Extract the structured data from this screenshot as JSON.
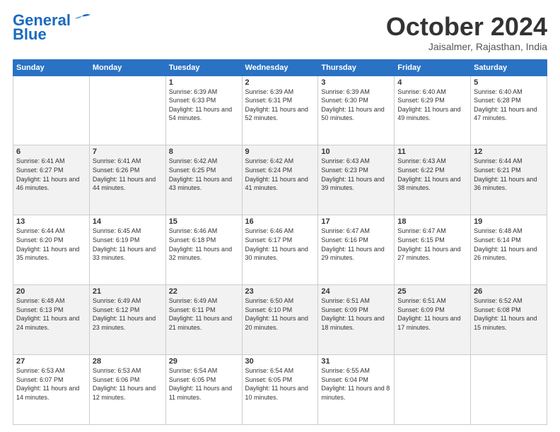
{
  "header": {
    "logo_line1": "General",
    "logo_line2": "Blue",
    "month": "October 2024",
    "location": "Jaisalmer, Rajasthan, India"
  },
  "weekdays": [
    "Sunday",
    "Monday",
    "Tuesday",
    "Wednesday",
    "Thursday",
    "Friday",
    "Saturday"
  ],
  "weeks": [
    [
      {
        "day": "",
        "info": ""
      },
      {
        "day": "",
        "info": ""
      },
      {
        "day": "1",
        "info": "Sunrise: 6:39 AM\nSunset: 6:33 PM\nDaylight: 11 hours and 54 minutes."
      },
      {
        "day": "2",
        "info": "Sunrise: 6:39 AM\nSunset: 6:31 PM\nDaylight: 11 hours and 52 minutes."
      },
      {
        "day": "3",
        "info": "Sunrise: 6:39 AM\nSunset: 6:30 PM\nDaylight: 11 hours and 50 minutes."
      },
      {
        "day": "4",
        "info": "Sunrise: 6:40 AM\nSunset: 6:29 PM\nDaylight: 11 hours and 49 minutes."
      },
      {
        "day": "5",
        "info": "Sunrise: 6:40 AM\nSunset: 6:28 PM\nDaylight: 11 hours and 47 minutes."
      }
    ],
    [
      {
        "day": "6",
        "info": "Sunrise: 6:41 AM\nSunset: 6:27 PM\nDaylight: 11 hours and 46 minutes."
      },
      {
        "day": "7",
        "info": "Sunrise: 6:41 AM\nSunset: 6:26 PM\nDaylight: 11 hours and 44 minutes."
      },
      {
        "day": "8",
        "info": "Sunrise: 6:42 AM\nSunset: 6:25 PM\nDaylight: 11 hours and 43 minutes."
      },
      {
        "day": "9",
        "info": "Sunrise: 6:42 AM\nSunset: 6:24 PM\nDaylight: 11 hours and 41 minutes."
      },
      {
        "day": "10",
        "info": "Sunrise: 6:43 AM\nSunset: 6:23 PM\nDaylight: 11 hours and 39 minutes."
      },
      {
        "day": "11",
        "info": "Sunrise: 6:43 AM\nSunset: 6:22 PM\nDaylight: 11 hours and 38 minutes."
      },
      {
        "day": "12",
        "info": "Sunrise: 6:44 AM\nSunset: 6:21 PM\nDaylight: 11 hours and 36 minutes."
      }
    ],
    [
      {
        "day": "13",
        "info": "Sunrise: 6:44 AM\nSunset: 6:20 PM\nDaylight: 11 hours and 35 minutes."
      },
      {
        "day": "14",
        "info": "Sunrise: 6:45 AM\nSunset: 6:19 PM\nDaylight: 11 hours and 33 minutes."
      },
      {
        "day": "15",
        "info": "Sunrise: 6:46 AM\nSunset: 6:18 PM\nDaylight: 11 hours and 32 minutes."
      },
      {
        "day": "16",
        "info": "Sunrise: 6:46 AM\nSunset: 6:17 PM\nDaylight: 11 hours and 30 minutes."
      },
      {
        "day": "17",
        "info": "Sunrise: 6:47 AM\nSunset: 6:16 PM\nDaylight: 11 hours and 29 minutes."
      },
      {
        "day": "18",
        "info": "Sunrise: 6:47 AM\nSunset: 6:15 PM\nDaylight: 11 hours and 27 minutes."
      },
      {
        "day": "19",
        "info": "Sunrise: 6:48 AM\nSunset: 6:14 PM\nDaylight: 11 hours and 26 minutes."
      }
    ],
    [
      {
        "day": "20",
        "info": "Sunrise: 6:48 AM\nSunset: 6:13 PM\nDaylight: 11 hours and 24 minutes."
      },
      {
        "day": "21",
        "info": "Sunrise: 6:49 AM\nSunset: 6:12 PM\nDaylight: 11 hours and 23 minutes."
      },
      {
        "day": "22",
        "info": "Sunrise: 6:49 AM\nSunset: 6:11 PM\nDaylight: 11 hours and 21 minutes."
      },
      {
        "day": "23",
        "info": "Sunrise: 6:50 AM\nSunset: 6:10 PM\nDaylight: 11 hours and 20 minutes."
      },
      {
        "day": "24",
        "info": "Sunrise: 6:51 AM\nSunset: 6:09 PM\nDaylight: 11 hours and 18 minutes."
      },
      {
        "day": "25",
        "info": "Sunrise: 6:51 AM\nSunset: 6:09 PM\nDaylight: 11 hours and 17 minutes."
      },
      {
        "day": "26",
        "info": "Sunrise: 6:52 AM\nSunset: 6:08 PM\nDaylight: 11 hours and 15 minutes."
      }
    ],
    [
      {
        "day": "27",
        "info": "Sunrise: 6:53 AM\nSunset: 6:07 PM\nDaylight: 11 hours and 14 minutes."
      },
      {
        "day": "28",
        "info": "Sunrise: 6:53 AM\nSunset: 6:06 PM\nDaylight: 11 hours and 12 minutes."
      },
      {
        "day": "29",
        "info": "Sunrise: 6:54 AM\nSunset: 6:05 PM\nDaylight: 11 hours and 11 minutes."
      },
      {
        "day": "30",
        "info": "Sunrise: 6:54 AM\nSunset: 6:05 PM\nDaylight: 11 hours and 10 minutes."
      },
      {
        "day": "31",
        "info": "Sunrise: 6:55 AM\nSunset: 6:04 PM\nDaylight: 11 hours and 8 minutes."
      },
      {
        "day": "",
        "info": ""
      },
      {
        "day": "",
        "info": ""
      }
    ]
  ]
}
